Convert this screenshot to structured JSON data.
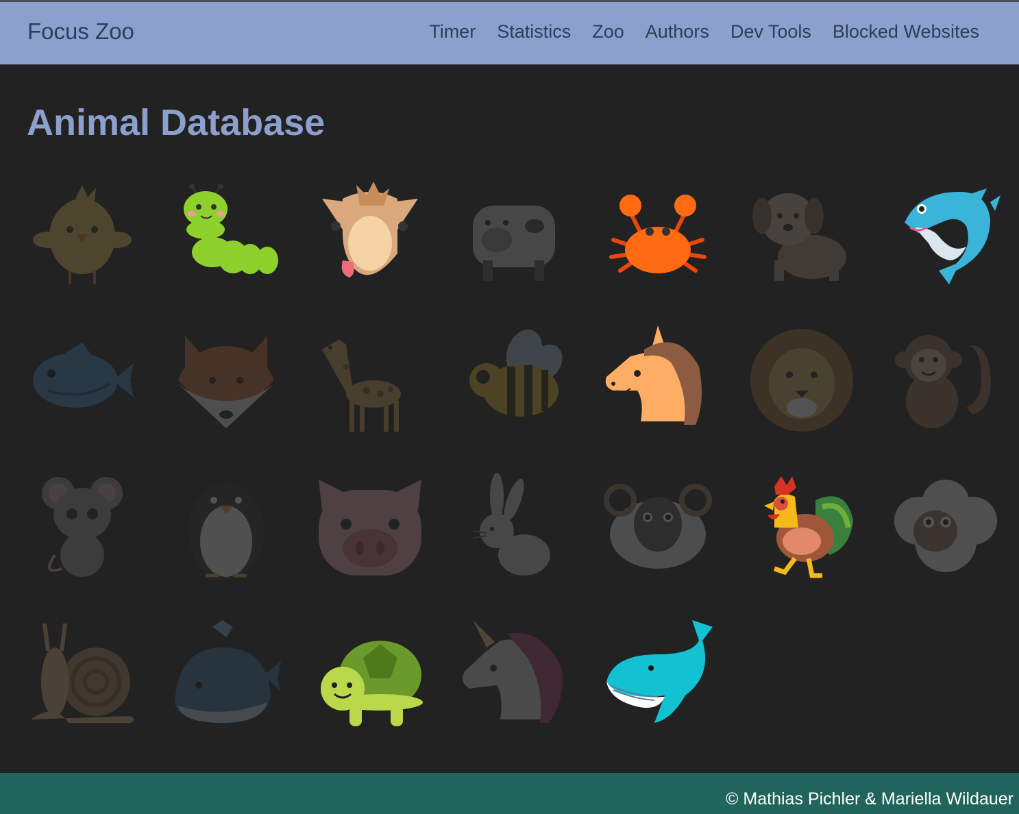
{
  "header": {
    "brand": "Focus Zoo",
    "nav": [
      "Timer",
      "Statistics",
      "Zoo",
      "Authors",
      "Dev Tools",
      "Blocked Websites"
    ]
  },
  "main": {
    "title": "Animal Database"
  },
  "animals": [
    {
      "name": "chick",
      "unlocked": false
    },
    {
      "name": "caterpillar",
      "unlocked": true
    },
    {
      "name": "camel",
      "unlocked": true
    },
    {
      "name": "cow",
      "unlocked": false
    },
    {
      "name": "crab",
      "unlocked": true
    },
    {
      "name": "dog",
      "unlocked": false
    },
    {
      "name": "dolphin",
      "unlocked": true
    },
    {
      "name": "fish",
      "unlocked": false
    },
    {
      "name": "fox",
      "unlocked": false
    },
    {
      "name": "giraffe",
      "unlocked": false
    },
    {
      "name": "bee",
      "unlocked": false
    },
    {
      "name": "horse",
      "unlocked": true
    },
    {
      "name": "lion",
      "unlocked": false
    },
    {
      "name": "monkey",
      "unlocked": false
    },
    {
      "name": "mouse",
      "unlocked": false
    },
    {
      "name": "penguin",
      "unlocked": false
    },
    {
      "name": "pig",
      "unlocked": false
    },
    {
      "name": "rabbit",
      "unlocked": false
    },
    {
      "name": "ram",
      "unlocked": false
    },
    {
      "name": "rooster",
      "unlocked": true
    },
    {
      "name": "sheep",
      "unlocked": false
    },
    {
      "name": "snail",
      "unlocked": false
    },
    {
      "name": "whale",
      "unlocked": false
    },
    {
      "name": "turtle",
      "unlocked": true
    },
    {
      "name": "unicorn",
      "unlocked": false
    },
    {
      "name": "blue-whale",
      "unlocked": true
    }
  ],
  "footer": {
    "copyright": "© Mathias Pichler & Mariella Wildauer"
  },
  "colors": {
    "navbar": "#8ca0cd",
    "background": "#222222",
    "footer": "#20645b",
    "title": "#8ca0cd"
  }
}
